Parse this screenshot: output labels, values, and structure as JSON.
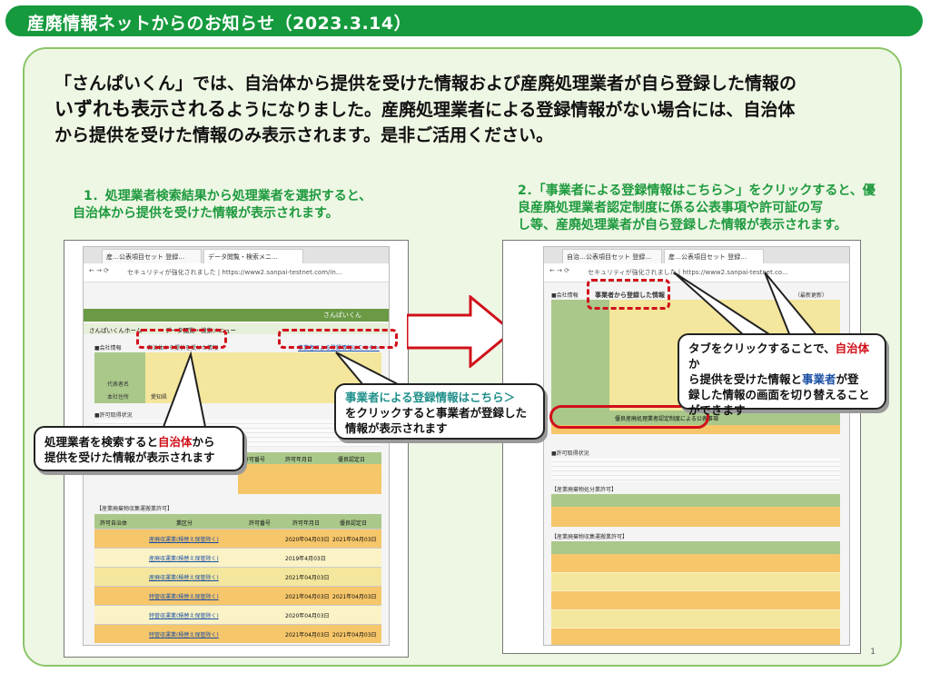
{
  "header": {
    "title": "産廃情報ネットからのお知らせ（2023.3.14）"
  },
  "intro": {
    "line1": "「さんぱいくん」では、自治体から提供を受けた情報および産廃処理業者が自ら登録した情報の",
    "line2_bold": "いずれも表示される",
    "line2_rest": "ようになりました。産廃処理業者による登録情報がない場合には、自治体",
    "line3": "から提供を受けた情報のみ表示されます。是非ご活用ください。"
  },
  "step1": {
    "line1": "1．処理業者検索結果から処理業者を選択すると、",
    "line2": "自治体から提供を受けた情報が表示されます。"
  },
  "step2": {
    "line1": "2．「事業者による登録情報はこちら＞」をクリックすると、優",
    "line2": "良産廃処理業者認定制度に係る公表事項や許可証の写",
    "line3": "し等、産廃処理業者が自ら登録した情報が表示されます。"
  },
  "left_shot": {
    "tab1": "産…公表項目セット 登録…",
    "tab2": "データ閲覧・検索メニ…",
    "url": "セキュリティが強化されました | https://www2.sanpai-testnet.com/in...",
    "banner": "さんぱいくん",
    "nav1": "さんぱいくんホーム",
    "nav2": "データ閲覧・検索メニュー",
    "company_label": "■会社情報",
    "link_jichitai": "自治体から提供を受けた情報",
    "link_jigyosha": "事業者による登録情報はこちら＞",
    "row_rep": "代表者名",
    "row_addr": "本社住所",
    "addr_val": "愛知県",
    "permit_label": "■許可取得状況",
    "col_no": "許可番号",
    "col_date": "許可年月日",
    "col_yuryo": "優良認定日",
    "list2_label": "【産業廃棄物収集運搬業許可】",
    "col_area": "許可自治体",
    "col_kubun": "業区分",
    "rows": [
      {
        "kubun": "産廃収運業(積替え保管除く)",
        "date": "2020年04月03日",
        "yuryo": "2021年04月03日"
      },
      {
        "kubun": "産廃収運業(積替え保管除く)",
        "date": "2019年4月03日",
        "yuryo": ""
      },
      {
        "kubun": "産廃収運業(積替え保管除く)",
        "date": "2021年04月03日",
        "yuryo": ""
      },
      {
        "kubun": "特管収運業(積替え保管除く)",
        "date": "2021年04月03日",
        "yuryo": "2021年04月03日"
      },
      {
        "kubun": "特管収運業(積替え保管除く)",
        "date": "2020年04月03日",
        "yuryo": ""
      },
      {
        "kubun": "特管収運業(積替え保管除く)",
        "date": "2021年04月03日",
        "yuryo": "2021年04月03日"
      }
    ]
  },
  "right_shot": {
    "tab1": "自治…公表項目セット 登録…",
    "tab2": "産…公表項目セット 登録…",
    "url": "セキュリティが強化されました | https://www2.sanpai-testnet.co...",
    "tab_jigyosha": "事業者から登録した情報",
    "company_label": "■会社情報",
    "update_label": "（最新更新）",
    "permit_label": "■許可取得状況",
    "yuryo_row": "優良産廃処理業者認定制度による公表事項",
    "list1_label": "【産業廃棄物処分業許可】",
    "list2_label": "【産業廃棄物収集運搬業許可】"
  },
  "callout_left": {
    "part1": "処理業者を検索すると",
    "part2": "自治体",
    "part3": "から",
    "line2": "提供を受けた情報が表示されます"
  },
  "callout_mid": {
    "line1": "事業者による登録情報はこちら＞",
    "line2": "をクリックすると事業者が登録した",
    "line3": "情報が表示されます"
  },
  "callout_right": {
    "p1": "タブをクリックすることで、",
    "p2": "自治体",
    "p3": "か",
    "p4": "ら提供を受けた情報と",
    "p5": "事業者",
    "p6": "が登",
    "p7": "録した情報の画面を切り替えること",
    "p8": "ができます"
  },
  "page_number": "1",
  "colors": {
    "green": "#159a3e",
    "red": "#d0101a",
    "panel": "#eef6e4"
  }
}
